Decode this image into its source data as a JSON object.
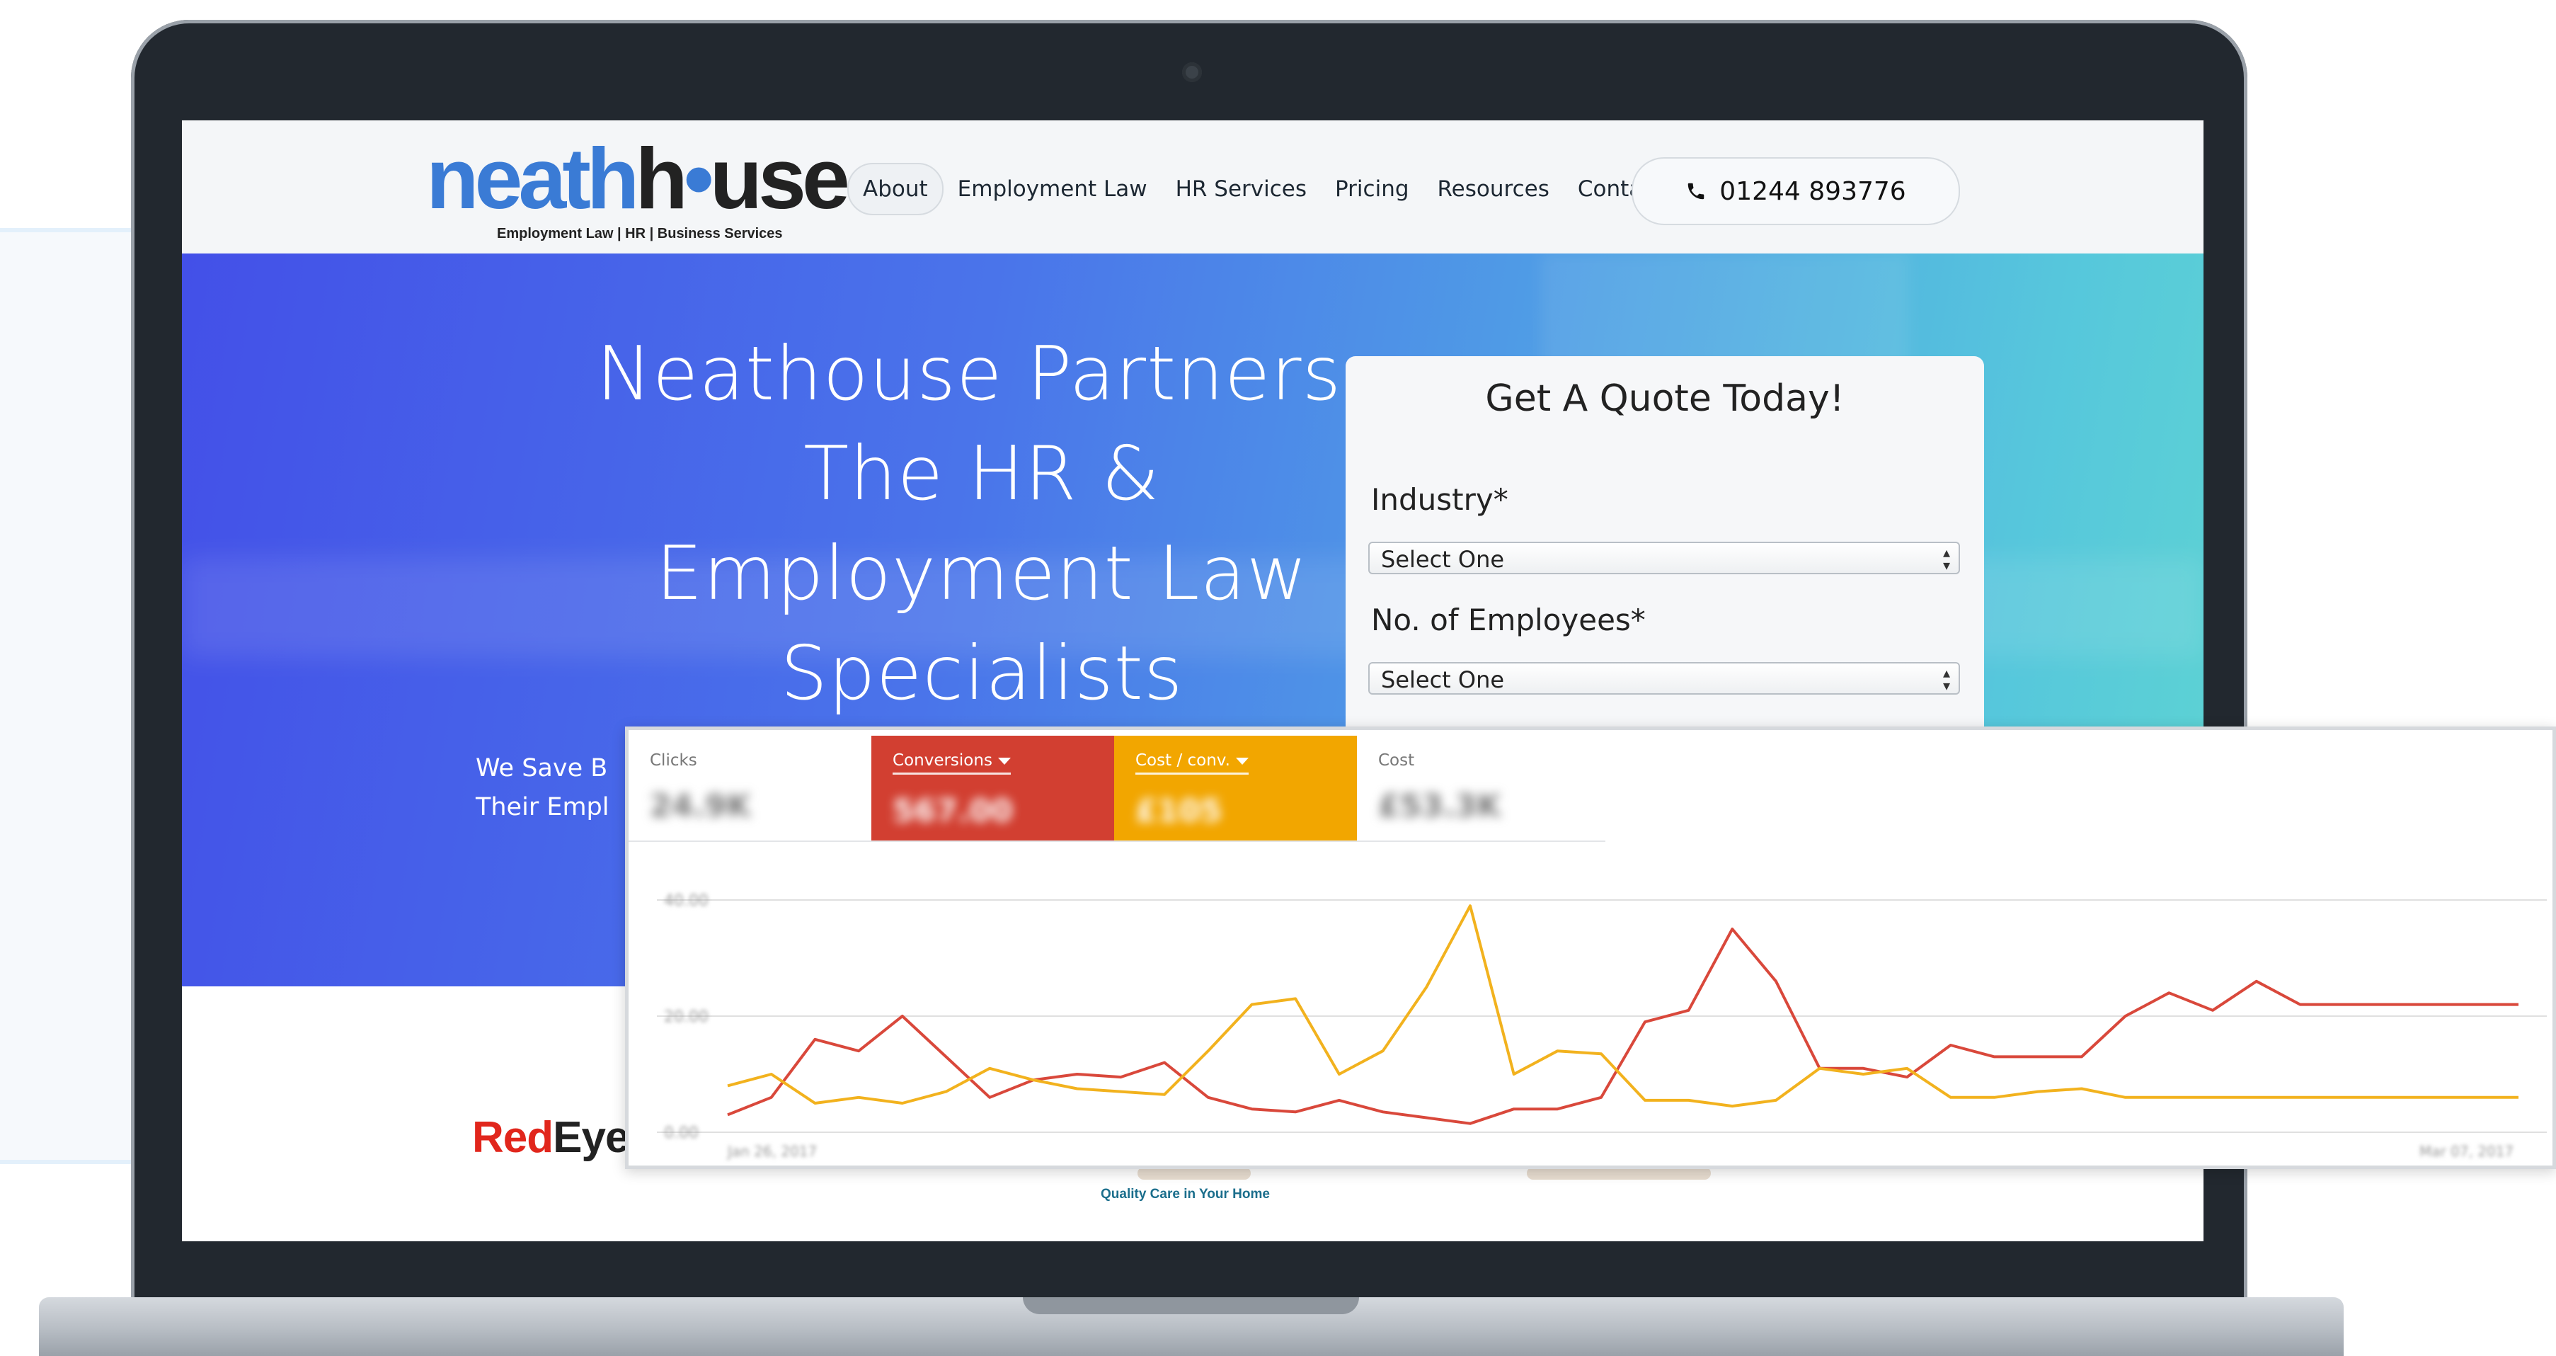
{
  "site": {
    "logo": {
      "word_blue": "neath",
      "word_dark": "h",
      "word_dot": "•",
      "word_end": "use",
      "tagline": "Employment Law | HR | Business Services"
    },
    "nav": [
      "About",
      "Employment Law",
      "HR Services",
      "Pricing",
      "Resources",
      "Contact"
    ],
    "active_nav": "About",
    "phone": "01244 893776",
    "hero": {
      "title_lines": [
        "Neathouse Partners:",
        "The HR &",
        "Employment Law",
        "Specialists"
      ],
      "subtitle_lines": [
        "We Save B",
        "Their Empl"
      ]
    },
    "quote_form": {
      "title": "Get A Quote Today!",
      "industry_label": "Industry*",
      "industry_value": "Select One",
      "employees_label": "No. of Employees*",
      "employees_value": "Select One"
    },
    "client_logos": {
      "redeye_red": "Red",
      "redeye_dark": "Eye",
      "care_tagline": "Quality Care in Your Home"
    }
  },
  "analytics": {
    "metrics": [
      {
        "label": "Clicks",
        "value": "24.9K",
        "color": "#ffffff",
        "selected": false
      },
      {
        "label": "Conversions",
        "value": "567.00",
        "color": "#d23f31",
        "selected": true
      },
      {
        "label": "Cost / conv.",
        "value": "£105",
        "color": "#f2a600",
        "selected": true
      },
      {
        "label": "Cost",
        "value": "£53.3K",
        "color": "#ffffff",
        "selected": false
      }
    ],
    "chart_data": {
      "type": "line",
      "x": [
        "Jan 26, 2017",
        "",
        "",
        "",
        "",
        "",
        "",
        "",
        "",
        "",
        "",
        "",
        "",
        "",
        "",
        "",
        "",
        "",
        "",
        "",
        "",
        "",
        "",
        "",
        "",
        "",
        "",
        "",
        "",
        "",
        "",
        "",
        "",
        "",
        "",
        "",
        "",
        "",
        "",
        "",
        "",
        "Mar 07, 2017"
      ],
      "ylim": [
        0,
        40
      ],
      "yticks": [
        "0.00",
        "20.00",
        "40.00"
      ],
      "grid": true,
      "series": [
        {
          "name": "Conversions",
          "color": "#d9483b",
          "values": [
            3,
            6,
            16,
            14,
            20,
            13,
            6,
            9,
            10,
            9.5,
            12,
            6,
            4,
            3.5,
            5.5,
            3.5,
            2.5,
            1.5,
            4,
            4,
            6,
            19,
            21,
            35,
            26,
            11,
            11,
            9.5,
            15,
            13,
            13,
            13,
            20,
            24,
            21,
            26,
            22,
            22,
            22,
            22,
            22,
            22
          ]
        },
        {
          "name": "Cost / conv.",
          "color": "#f2b21e",
          "values": [
            8,
            10,
            5,
            6,
            5,
            7,
            11,
            9,
            7.5,
            7,
            6.5,
            14,
            22,
            23,
            10,
            14,
            25,
            39,
            10,
            14,
            13.5,
            5.5,
            5.5,
            4.5,
            5.5,
            11,
            10,
            11,
            6,
            6,
            7,
            7.5,
            6,
            6,
            6,
            6,
            6,
            6,
            6,
            6,
            6,
            6
          ]
        }
      ]
    }
  }
}
